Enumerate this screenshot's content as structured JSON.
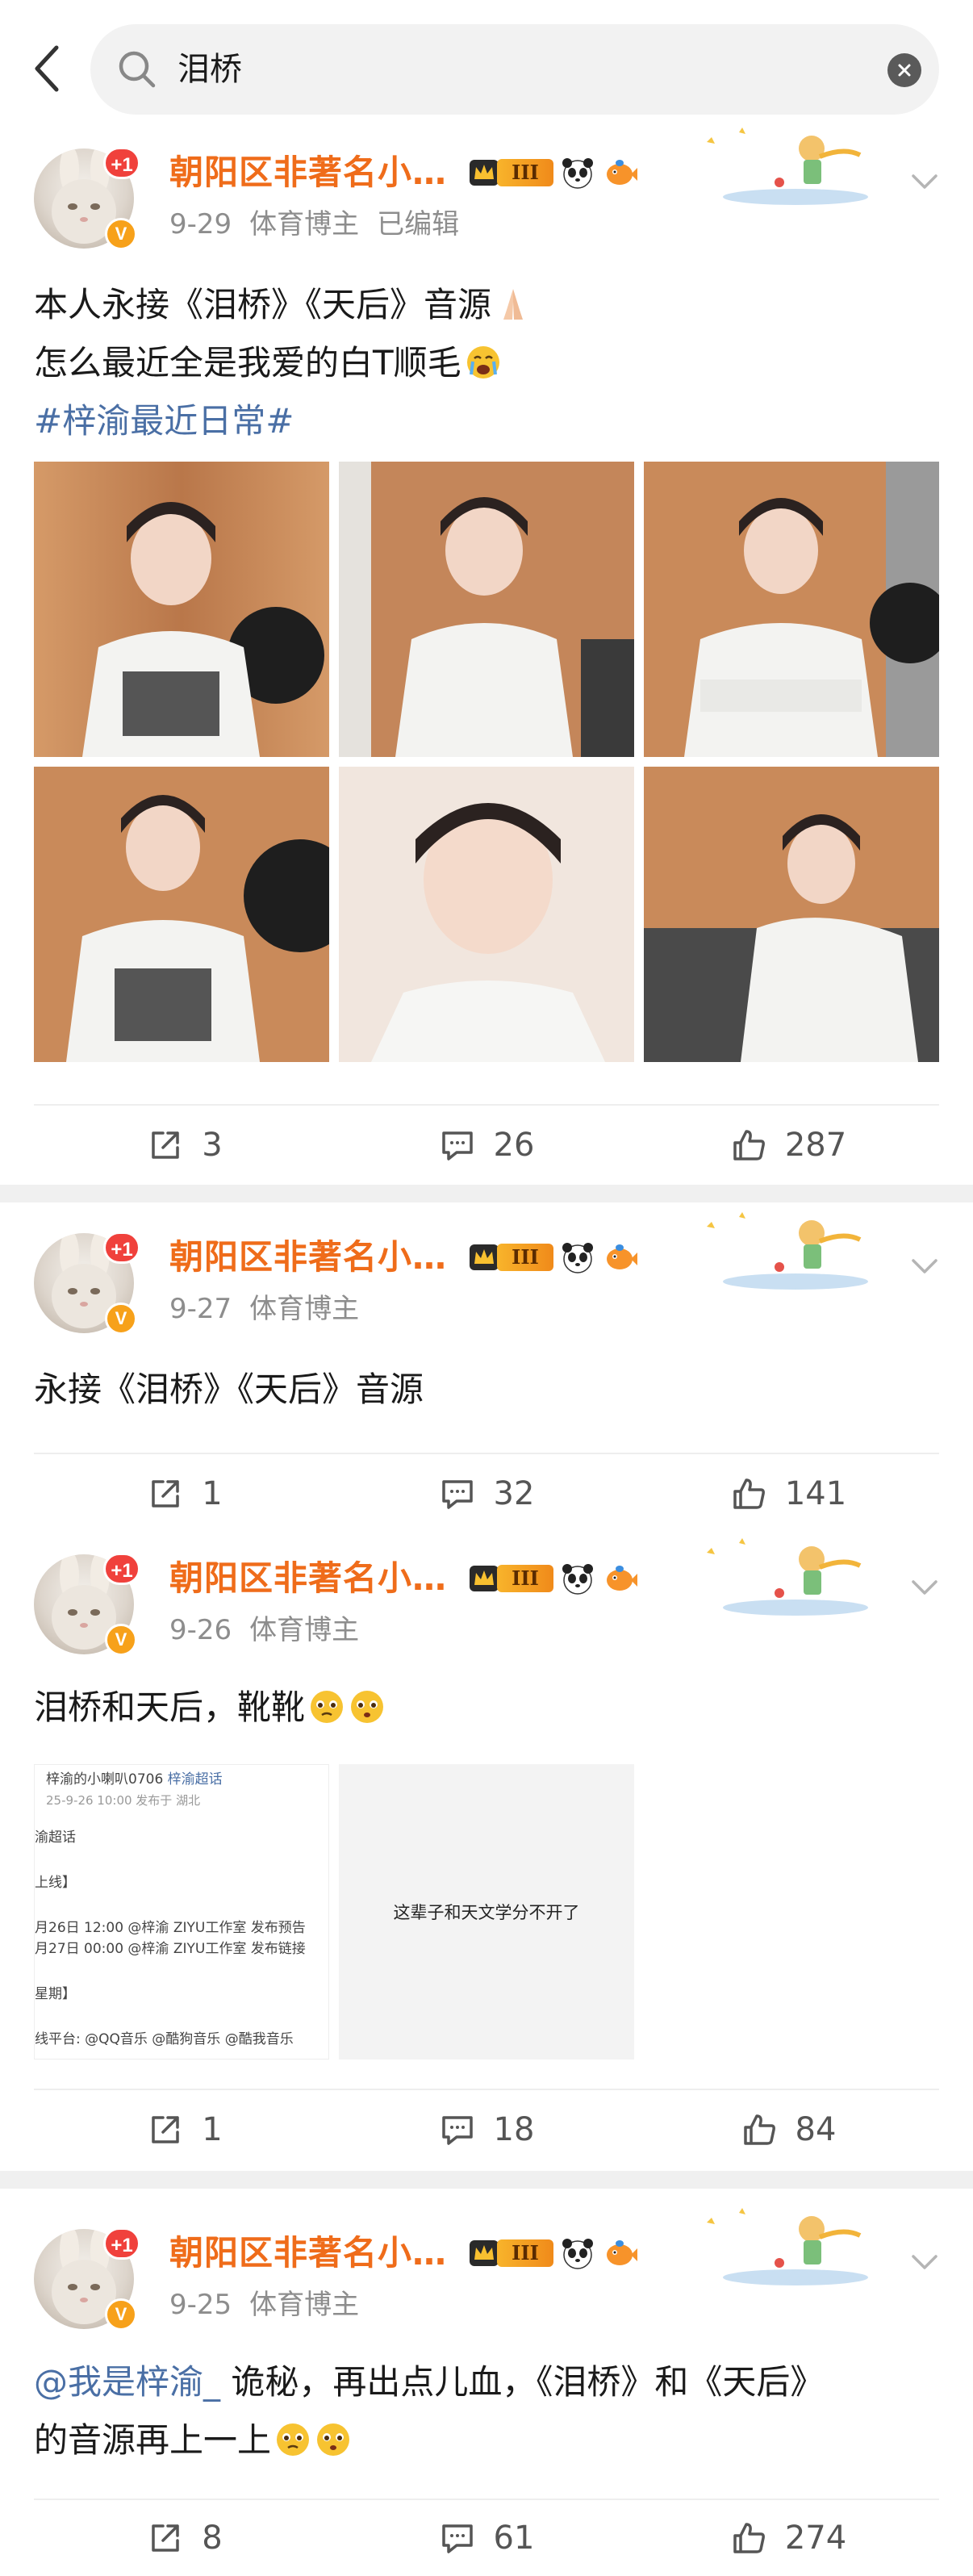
{
  "search": {
    "query": "泪桥"
  },
  "posts": [
    {
      "username": "朝阳区非著名小…",
      "badge_count": "+1",
      "vip_level": "III",
      "date": "9-29",
      "source": "体育博主",
      "edited": "已编辑",
      "text_line1": "本人永接《泪桥》《天后》音源",
      "text_line2": "怎么最近全是我爱的白T顺毛",
      "topic": "#梓渝最近日常#",
      "reposts": "3",
      "comments": "26",
      "likes": "287"
    },
    {
      "username": "朝阳区非著名小…",
      "badge_count": "+1",
      "vip_level": "III",
      "date": "9-27",
      "source": "体育博主",
      "text_line1": "永接《泪桥》《天后》音源",
      "reposts": "1",
      "comments": "32",
      "likes": "141"
    },
    {
      "username": "朝阳区非著名小…",
      "badge_count": "+1",
      "vip_level": "III",
      "date": "9-26",
      "source": "体育博主",
      "text_line1": "泪桥和天后，靴靴",
      "attachment_doc": {
        "line1": "梓渝的小喇叭0706",
        "line1b": "梓渝超话",
        "line2": "25-9-26 10:00  发布于 湖北",
        "line3": "渝超话",
        "line4": "上线】",
        "line5": "月26日 12:00 @梓渝 ZIYU工作室 发布预告",
        "line6": "月27日 00:00 @梓渝 ZIYU工作室 发布链接",
        "line7": "星期】",
        "line8": "线平台: @QQ音乐 @酷狗音乐 @酷我音乐"
      },
      "attachment_text": "这辈子和天文学分不开了",
      "reposts": "1",
      "comments": "18",
      "likes": "84"
    },
    {
      "username": "朝阳区非著名小…",
      "badge_count": "+1",
      "vip_level": "III",
      "date": "9-25",
      "source": "体育博主",
      "mention": "@我是梓渝_",
      "text_line1_rest": " 诡秘，再出点儿血，《泪桥》和《天后》",
      "text_line2": "的音源再上一上",
      "reposts": "8",
      "comments": "61",
      "likes": "274"
    }
  ],
  "colors": {
    "username": "#ef6c1a",
    "topic": "#4a6fa5",
    "meta": "#8d8d8d",
    "badge": "#f0413c",
    "verify": "#f7a11a"
  },
  "icons": [
    "back-arrow-icon",
    "search-icon",
    "clear-icon",
    "crown-icon",
    "panda-icon",
    "fish-icon",
    "chevron-down-icon",
    "repost-icon",
    "comment-icon",
    "like-icon",
    "praying-hands-emoji",
    "crying-face-emoji",
    "pleading-face-emoji"
  ]
}
